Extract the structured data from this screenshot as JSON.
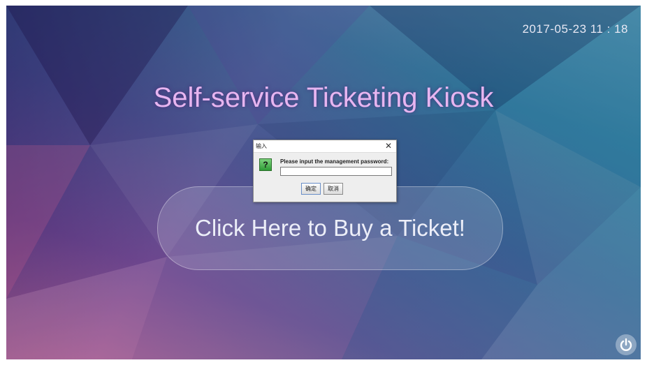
{
  "clock": {
    "datetime": "2017-05-23  11 : 18"
  },
  "main": {
    "title": "Self-service Ticketing Kiosk",
    "buy_button_label": "Click Here to Buy a Ticket!"
  },
  "power_button": {
    "icon": "power-icon"
  },
  "dialog": {
    "title": "输入",
    "close_glyph": "✕",
    "icon_glyph": "?",
    "message": "Please input the management password:",
    "input_value": "",
    "ok_label": "确定",
    "cancel_label": "取消"
  }
}
